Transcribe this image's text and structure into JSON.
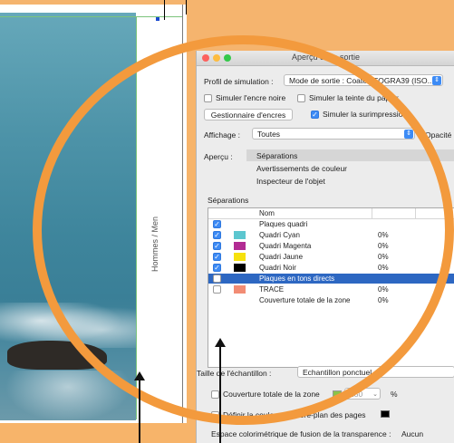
{
  "document": {
    "vertical_label": "Hommes / Men"
  },
  "window": {
    "title": "Aperçu de la sortie"
  },
  "simulation": {
    "label": "Profil de simulation :",
    "value": "Mode de sortie : Coated FOGRA39 (ISO..."
  },
  "options": {
    "simulate_black_ink": "Simuler l'encre noire",
    "simulate_paper": "Simuler la teinte du papier",
    "ink_manager_button": "Gestionnaire d'encres",
    "simulate_overprint": "Simuler la surimpression"
  },
  "display": {
    "label": "Affichage :",
    "value": "Toutes",
    "opacity_label": "Opacité"
  },
  "preview": {
    "label": "Aperçu :",
    "items": [
      "Séparations",
      "Avertissements de couleur",
      "Inspecteur de l'objet"
    ]
  },
  "separations": {
    "section_label": "Séparations",
    "column_name": "Nom",
    "rows": [
      {
        "name": "Plaques quadri",
        "pct": "",
        "checked": true,
        "color": ""
      },
      {
        "name": "Quadri Cyan",
        "pct": "0%",
        "checked": true,
        "color": "#5cc6cf"
      },
      {
        "name": "Quadri Magenta",
        "pct": "0%",
        "checked": true,
        "color": "#b22c93"
      },
      {
        "name": "Quadri Jaune",
        "pct": "0%",
        "checked": true,
        "color": "#f6e10c"
      },
      {
        "name": "Quadri Noir",
        "pct": "0%",
        "checked": true,
        "color": "#000000"
      },
      {
        "name": "Plaques en tons directs",
        "pct": "",
        "checked": false,
        "color": "",
        "selected": true
      },
      {
        "name": "TRACE",
        "pct": "0%",
        "checked": false,
        "color": "#f28c74"
      },
      {
        "name": "Couverture totale de la zone",
        "pct": "0%",
        "checked": false,
        "color": ""
      }
    ]
  },
  "sample": {
    "label": "Taille de l'échantillon :",
    "value": "Echantillon ponctuel"
  },
  "coverage": {
    "label": "Couverture totale de la zone",
    "value": "280",
    "unit": "%",
    "highlight_color": "#8bc34a"
  },
  "background": {
    "label": "Définir la couleur d'arrière-plan des pages",
    "swatch_color": "#000000"
  },
  "transparency": {
    "label": "Espace colorimétrique de fusion de la transparence :",
    "value": "Aucun"
  },
  "annotation": {
    "ring_color": "#f39a3d"
  }
}
